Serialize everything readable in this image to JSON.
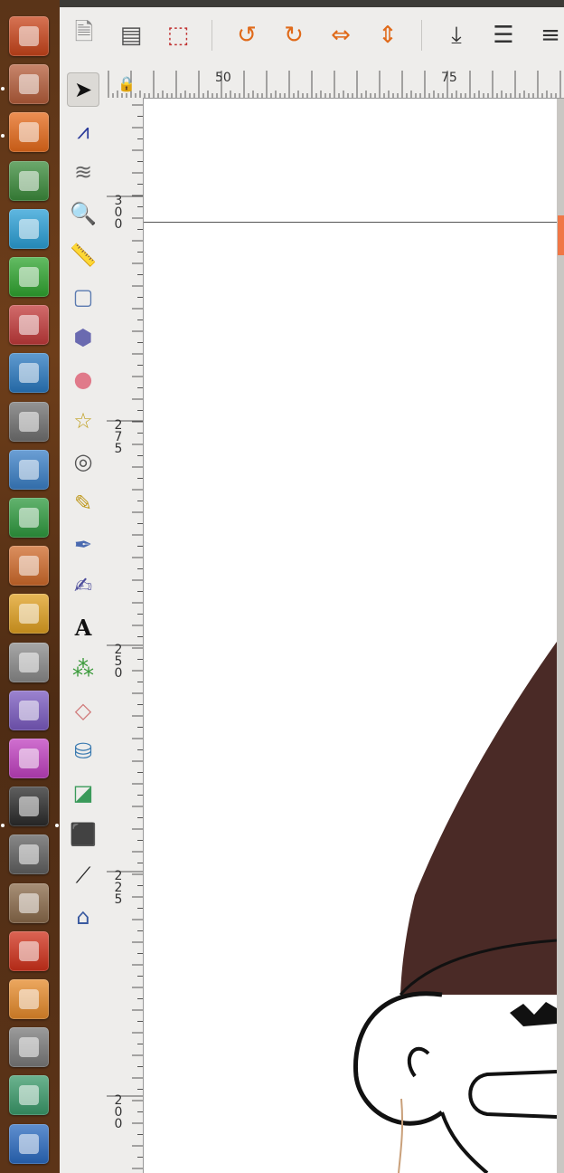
{
  "launcher": {
    "items": [
      {
        "name": "dash-icon",
        "color": "#c9441a"
      },
      {
        "name": "file-manager-icon",
        "color": "#b55d3a"
      },
      {
        "name": "firefox-icon",
        "color": "#e66a1a"
      },
      {
        "name": "chrome-icon",
        "color": "#3b8b3b"
      },
      {
        "name": "telegram-icon",
        "color": "#2a9fd6"
      },
      {
        "name": "green-pipe-icon",
        "color": "#2fa52f"
      },
      {
        "name": "popcorn-icon",
        "color": "#c33a3a"
      },
      {
        "name": "kodi-icon",
        "color": "#2a79c0"
      },
      {
        "name": "calculator-icon",
        "color": "#707070"
      },
      {
        "name": "writer-icon",
        "color": "#3a7fc6"
      },
      {
        "name": "calc-icon",
        "color": "#2e9a3e"
      },
      {
        "name": "impress-icon",
        "color": "#d06a2a"
      },
      {
        "name": "draw-icon",
        "color": "#e0a020"
      },
      {
        "name": "text-editor-icon",
        "color": "#8a8a8a"
      },
      {
        "name": "image-viewer-icon",
        "color": "#7a5ac0"
      },
      {
        "name": "color-picker-icon",
        "color": "#c040c0"
      },
      {
        "name": "inkscape-icon",
        "color": "#2a2a2a"
      },
      {
        "name": "screenshot-icon",
        "color": "#606060"
      },
      {
        "name": "gimp-icon",
        "color": "#8a6a4a"
      },
      {
        "name": "fontforge-icon",
        "color": "#d0301a"
      },
      {
        "name": "blender-icon",
        "color": "#e68a2a"
      },
      {
        "name": "3d-model-icon",
        "color": "#7a7a7a"
      },
      {
        "name": "geometry-icon",
        "color": "#3a9a6a"
      },
      {
        "name": "app-icon",
        "color": "#2a6ac0"
      }
    ]
  },
  "toolbar": {
    "buttons": [
      {
        "name": "document-properties-icon",
        "glyph": "🗎",
        "color": "#888888"
      },
      {
        "name": "select-all-icon",
        "glyph": "▤",
        "color": "#555555"
      },
      {
        "name": "zoom-selection-icon",
        "glyph": "⬚",
        "color": "#c03030"
      },
      {
        "name": "rotate-ccw-icon",
        "glyph": "↺",
        "color": "#e06a1a"
      },
      {
        "name": "rotate-cw-icon",
        "glyph": "↻",
        "color": "#e06a1a"
      },
      {
        "name": "flip-horizontal-icon",
        "glyph": "⇔",
        "color": "#e06a1a"
      },
      {
        "name": "flip-vertical-icon",
        "glyph": "⇕",
        "color": "#e06a1a"
      },
      {
        "name": "lower-to-bottom-icon",
        "glyph": "⤓",
        "color": "#333333"
      },
      {
        "name": "raise-icon",
        "glyph": "☰",
        "color": "#333333"
      },
      {
        "name": "align-left-icon",
        "glyph": "≡",
        "color": "#333333"
      }
    ]
  },
  "tools": [
    {
      "name": "selector-tool-icon",
      "glyph": "➤",
      "color": "#111111",
      "active": true
    },
    {
      "name": "node-tool-icon",
      "glyph": "⩘",
      "color": "#2a3a9a"
    },
    {
      "name": "tweak-tool-icon",
      "glyph": "≋",
      "color": "#666666"
    },
    {
      "name": "zoom-tool-icon",
      "glyph": "🔍",
      "color": "#555555"
    },
    {
      "name": "measure-tool-icon",
      "glyph": "📏",
      "color": "#c08a4a"
    },
    {
      "name": "rectangle-tool-icon",
      "glyph": "▢",
      "color": "#5a7ab0"
    },
    {
      "name": "3d-box-tool-icon",
      "glyph": "⬢",
      "color": "#6a6ab0"
    },
    {
      "name": "ellipse-tool-icon",
      "glyph": "●",
      "color": "#e07a8a"
    },
    {
      "name": "star-tool-icon",
      "glyph": "☆",
      "color": "#c0a020"
    },
    {
      "name": "spiral-tool-icon",
      "glyph": "◎",
      "color": "#555555"
    },
    {
      "name": "pencil-tool-icon",
      "glyph": "✎",
      "color": "#c09a20"
    },
    {
      "name": "pen-tool-icon",
      "glyph": "✒",
      "color": "#4a6ab0"
    },
    {
      "name": "calligraphy-tool-icon",
      "glyph": "✍",
      "color": "#4a4a9a"
    },
    {
      "name": "text-tool-icon",
      "glyph": "A",
      "color": "#111111"
    },
    {
      "name": "spray-tool-icon",
      "glyph": "⁂",
      "color": "#3a9a3a"
    },
    {
      "name": "eraser-tool-icon",
      "glyph": "◇",
      "color": "#d07a7a"
    },
    {
      "name": "paint-bucket-tool-icon",
      "glyph": "⛁",
      "color": "#3a7ab0"
    },
    {
      "name": "gradient-tool-icon",
      "glyph": "◪",
      "color": "#3a9a5a"
    },
    {
      "name": "mesh-tool-icon",
      "glyph": "⬛",
      "color": "#2a8a6a"
    },
    {
      "name": "dropper-tool-icon",
      "glyph": "⟋",
      "color": "#222222"
    },
    {
      "name": "connector-tool-icon",
      "glyph": "⌂",
      "color": "#3a5aa0"
    }
  ],
  "rulers": {
    "horizontal_labels": [
      "50",
      "75"
    ],
    "vertical_labels": [
      "300",
      "275",
      "250",
      "225",
      "200"
    ]
  },
  "colors": {
    "hair": "#4a2a26",
    "scroll_accent": "#f07746"
  }
}
